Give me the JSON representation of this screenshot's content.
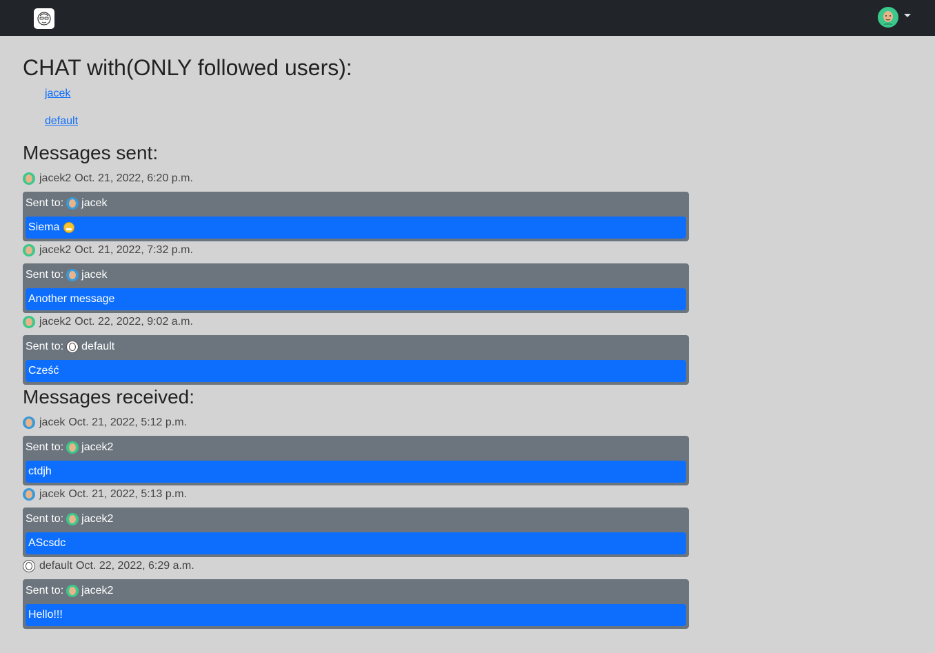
{
  "page": {
    "title": "CHAT with(ONLY followed users):"
  },
  "followed_users": [
    {
      "label": "jacek"
    },
    {
      "label": "default"
    }
  ],
  "sent": {
    "heading": "Messages sent:",
    "messages": [
      {
        "author": "jacek2",
        "time": "Oct. 21, 2022, 6:20 p.m.",
        "to_prefix": "Sent to:",
        "to": "jacek",
        "body": "Siema"
      },
      {
        "author": "jacek2",
        "time": "Oct. 21, 2022, 7:32 p.m.",
        "to_prefix": "Sent to:",
        "to": "jacek",
        "body": "Another message"
      },
      {
        "author": "jacek2",
        "time": "Oct. 22, 2022, 9:02 a.m.",
        "to_prefix": "Sent to:",
        "to": "default",
        "body": "Cześć"
      }
    ]
  },
  "received": {
    "heading": "Messages received:",
    "messages": [
      {
        "author": "jacek",
        "time": "Oct. 21, 2022, 5:12 p.m.",
        "to_prefix": "Sent to:",
        "to": "jacek2",
        "body": "ctdjh"
      },
      {
        "author": "jacek",
        "time": "Oct. 21, 2022, 5:13 p.m.",
        "to_prefix": "Sent to:",
        "to": "jacek2",
        "body": "AScsdc"
      },
      {
        "author": "default",
        "time": "Oct. 22, 2022, 6:29 a.m.",
        "to_prefix": "Sent to:",
        "to": "jacek2",
        "body": "Hello!!!"
      }
    ]
  },
  "colors": {
    "navbar": "#212529",
    "background": "#d3d3d3",
    "card": "#6c757d",
    "message_body": "#0d6efd",
    "link": "#0d6efd"
  },
  "icons": {
    "brand": "cartoon-face-logo-icon",
    "user_menu": "user-avatar-icon",
    "dropdown": "caret-down-icon"
  }
}
